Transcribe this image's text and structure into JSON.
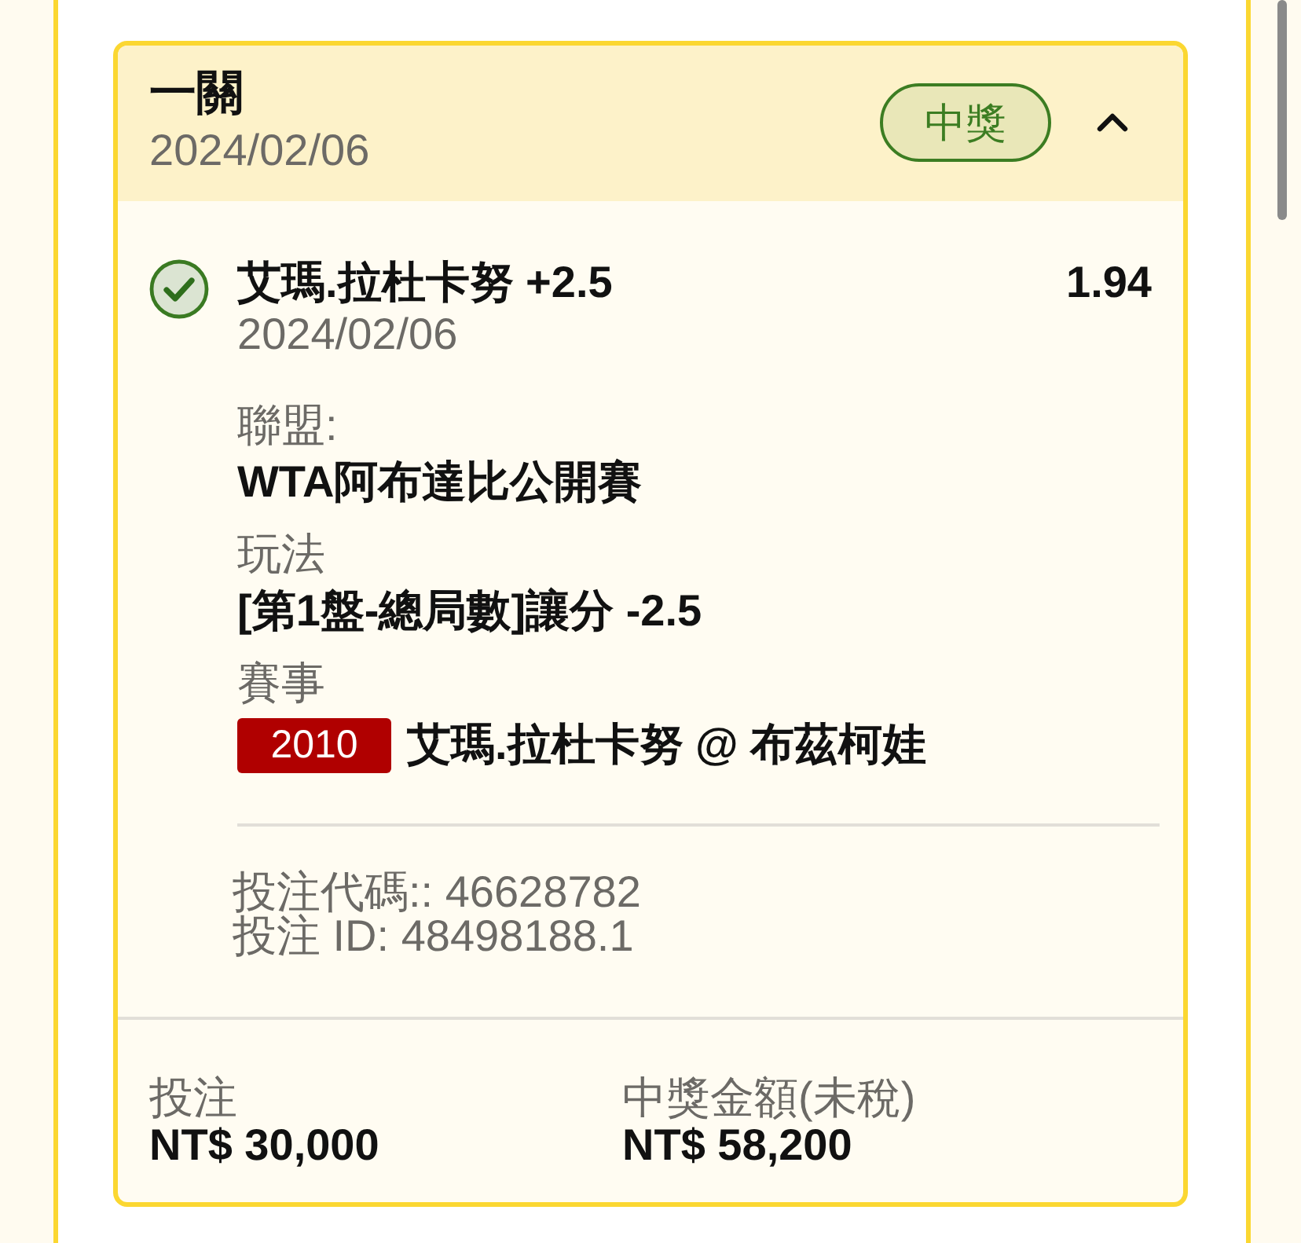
{
  "bet_card": {
    "title": "一關",
    "date": "2024/02/06",
    "status_badge": {
      "label": "中獎"
    },
    "expanded": true,
    "selection": {
      "won": true,
      "name": "艾瑪.拉杜卡努 +2.5",
      "odds": "1.94",
      "date": "2024/02/06"
    },
    "details": [
      {
        "label": "聯盟:",
        "value": "WTA阿布達比公開賽"
      },
      {
        "label": "玩法",
        "value": "[第1盤-總局數]讓分 -2.5"
      },
      {
        "label": "賽事",
        "match_code": "2010",
        "value": "艾瑪.拉杜卡努 @ 布茲柯娃"
      }
    ],
    "references": [
      "投注代碼:: 46628782",
      "投注 ID: 48498188.1"
    ],
    "totals": [
      {
        "label": "投注",
        "amount": "NT$ 30,000"
      },
      {
        "label": "中獎金額(未稅)",
        "amount": "NT$ 58,200"
      }
    ]
  }
}
